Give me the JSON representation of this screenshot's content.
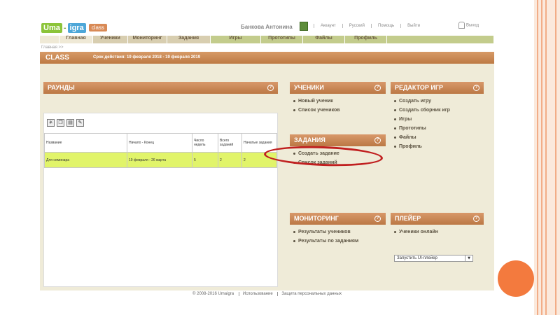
{
  "header": {
    "logo": {
      "part1": "Uma",
      "part2": "igra",
      "tag": "class"
    },
    "user_name": "Банкова Антонина",
    "links": [
      "Аккаунт",
      "Русский",
      "Помощь",
      "Выйти"
    ],
    "logout_label": "Выход"
  },
  "nav": {
    "tabs": [
      "Главная",
      "Ученики",
      "Мониторинг",
      "Задания",
      "Игры",
      "Прототипы",
      "Файлы",
      "Профиль"
    ]
  },
  "breadcrumb": "Главная >>",
  "class_bar": {
    "title": "CLASS",
    "period": "Срок действия: 19 февраля 2018 - 19 февраля 2019"
  },
  "rounds": {
    "title": "РАУНДЫ",
    "columns": [
      "Название",
      "Начало - Конец",
      "Число недель",
      "Всего заданий",
      "Начатые задания"
    ],
    "rows": [
      [
        "Для семинара",
        "19 февраля - 26 марта",
        "5",
        "2",
        "2"
      ]
    ]
  },
  "students": {
    "title": "УЧЕНИКИ",
    "items": [
      "Новый ученик",
      "Список учеников"
    ]
  },
  "tasks": {
    "title": "ЗАДАНИЯ",
    "items": [
      "Создать задание",
      "Список заданий"
    ]
  },
  "game_editor": {
    "title": "РЕДАКТОР ИГР",
    "items": [
      "Создать игру",
      "Создать сборник игр",
      "Игры",
      "Прототипы",
      "Файлы",
      "Профиль"
    ]
  },
  "monitoring": {
    "title": "МОНИТОРИНГ",
    "items": [
      "Результаты учеников",
      "Результаты по заданиям"
    ]
  },
  "player": {
    "title": "ПЛЕЙЕР",
    "items": [
      "Ученики онлайн"
    ],
    "select_value": "Запустить UI-плейер"
  },
  "help_symbol": "?",
  "footer": {
    "copyright": "© 2008-2016 Umaigra",
    "links": [
      "Использование",
      "Защита персональных данных"
    ]
  },
  "colors": {
    "panel_header": "#c58551",
    "content_bg": "#efebd8",
    "row_highlight": "#e1f46a",
    "annotation": "#c01f1f",
    "slide_accent": "#f37a3e"
  }
}
